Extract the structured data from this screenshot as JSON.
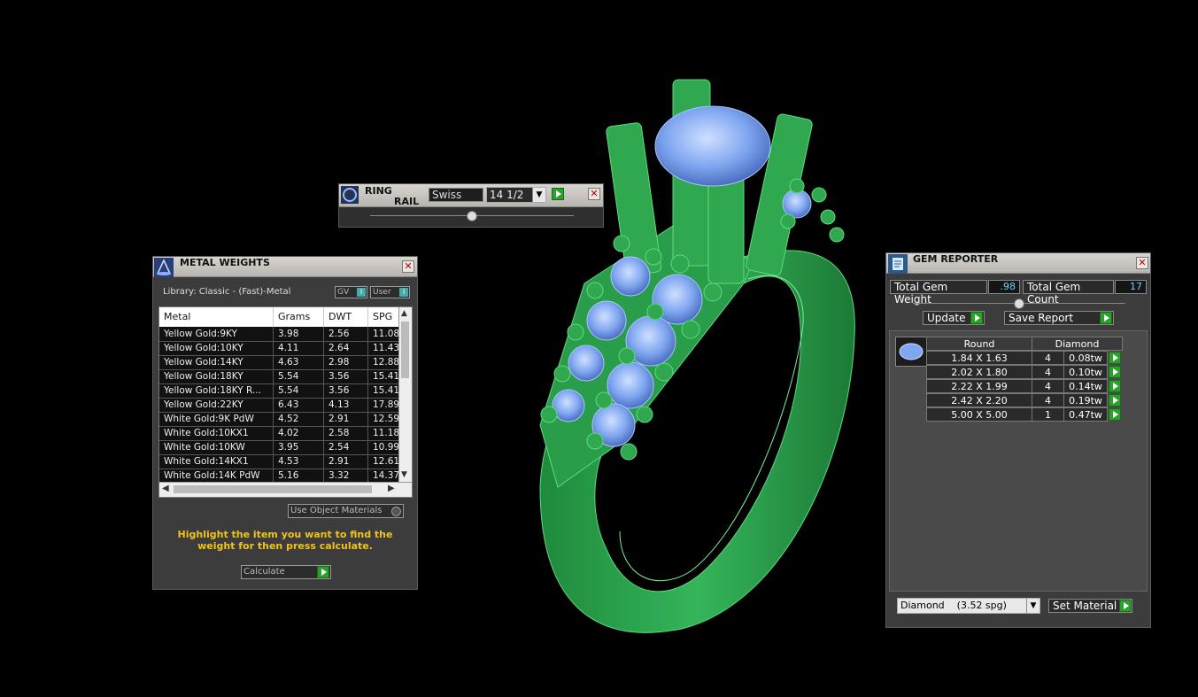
{
  "ring_rail": {
    "title_line1": "RING",
    "title_line2": "RAIL",
    "size_system": "Swiss",
    "size_value": "14 1/2"
  },
  "metal_weights": {
    "title": "METAL WEIGHTS",
    "library": "Library: Classic - (Fast)-Metal",
    "toggle_gv": "GV",
    "toggle_user": "User",
    "columns": [
      "Metal",
      "Grams",
      "DWT",
      "SPG"
    ],
    "rows": [
      [
        "Yellow Gold:9KY",
        "3.98",
        "2.56",
        "11.08"
      ],
      [
        "Yellow Gold:10KY",
        "4.11",
        "2.64",
        "11.43"
      ],
      [
        "Yellow Gold:14KY",
        "4.63",
        "2.98",
        "12.88"
      ],
      [
        "Yellow Gold:18KY",
        "5.54",
        "3.56",
        "15.41"
      ],
      [
        "Yellow Gold:18KY R...",
        "5.54",
        "3.56",
        "15.41"
      ],
      [
        "Yellow Gold:22KY",
        "6.43",
        "4.13",
        "17.89"
      ],
      [
        "White Gold:9K PdW",
        "4.52",
        "2.91",
        "12.59"
      ],
      [
        "White Gold:10KX1",
        "4.02",
        "2.58",
        "11.18"
      ],
      [
        "White Gold:10KW",
        "3.95",
        "2.54",
        "10.99"
      ],
      [
        "White Gold:14KX1",
        "4.53",
        "2.91",
        "12.61"
      ],
      [
        "White Gold:14K PdW",
        "5.16",
        "3.32",
        "14.37"
      ]
    ],
    "use_object_materials": "Use Object Materials",
    "message": "Highlight the item you want to find the weight for then press calculate.",
    "calculate": "Calculate"
  },
  "gem_reporter": {
    "title": "GEM REPORTER",
    "total_weight_label": "Total Gem Weight",
    "total_weight_value": ".98",
    "total_count_label": "Total Gem Count",
    "total_count_value": "17",
    "update_label": "Update",
    "save_report_label": "Save Report",
    "shape_header": "Round",
    "material_header": "Diamond",
    "gems": [
      {
        "size": "1.84 X 1.63",
        "count": "4",
        "weight": "0.08tw"
      },
      {
        "size": "2.02 X 1.80",
        "count": "4",
        "weight": "0.10tw"
      },
      {
        "size": "2.22 X 1.99",
        "count": "4",
        "weight": "0.14tw"
      },
      {
        "size": "2.42 X 2.20",
        "count": "4",
        "weight": "0.19tw"
      },
      {
        "size": "5.00 X 5.00",
        "count": "1",
        "weight": "0.47tw"
      }
    ],
    "material_select": "Diamond    (3.52 spg)",
    "set_material_label": "Set Material"
  },
  "colors": {
    "ring_green": "#2fa84f",
    "gem_blue": "#7fa6f0",
    "accent_yellow": "#f2c21b",
    "value_cyan": "#6cd0ff"
  }
}
